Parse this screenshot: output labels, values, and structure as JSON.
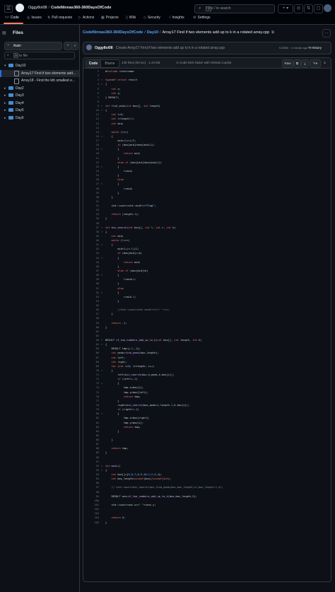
{
  "header": {
    "owner": "Oggy8oi08",
    "repo": "CodeNinnas360-360DaysOfCode",
    "search_placeholder": "Type / to search",
    "tabs": [
      {
        "label": "Code",
        "icon": "code-icon"
      },
      {
        "label": "Issues",
        "icon": "issue-icon"
      },
      {
        "label": "Pull requests",
        "icon": "pull-request-icon"
      },
      {
        "label": "Actions",
        "icon": "play-icon"
      },
      {
        "label": "Projects",
        "icon": "table-icon"
      },
      {
        "label": "Wiki",
        "icon": "book-icon"
      },
      {
        "label": "Security",
        "icon": "shield-icon"
      },
      {
        "label": "Insights",
        "icon": "graph-icon"
      },
      {
        "label": "Settings",
        "icon": "gear-icon"
      }
    ]
  },
  "sidebar": {
    "title": "Files",
    "branch": "main",
    "goto_placeholder": "Go to file",
    "goto_key": "t",
    "tree": [
      {
        "label": "Day10",
        "type": "folder",
        "open": true,
        "depth": 0
      },
      {
        "label": "Array17 Find if two elements add up to k in a rotated array.cpp",
        "display": "Array17 Find if two elements add...",
        "type": "file",
        "depth": 1,
        "selected": true
      },
      {
        "label": "Array18 - Find the kth smallest element",
        "display": "Array18 - Find the kth smallest e...",
        "type": "file",
        "depth": 1
      },
      {
        "label": "Day2",
        "type": "folder",
        "depth": 0
      },
      {
        "label": "Day3",
        "type": "folder",
        "depth": 0
      },
      {
        "label": "Day4",
        "type": "folder",
        "depth": 0
      },
      {
        "label": "Day5",
        "type": "folder",
        "depth": 0
      },
      {
        "label": "Day6",
        "type": "folder",
        "depth": 0
      }
    ]
  },
  "main": {
    "path_repo": "CodeNinnas360-360DaysOfCode",
    "path_folder": "Day10",
    "path_file": "Array17 Find if two elements add up to k in a rotated array.cpp",
    "commit": {
      "author": "Oggy8oi08",
      "message": "Create Array17 Find if two elements add up to k in a rotated array.cpp",
      "sha_time": "f125f3b · 1 minute ago",
      "history_label": "History"
    },
    "toolbar": {
      "code_tab": "Code",
      "blame_tab": "Blame",
      "file_info": "140 lines (94 loc) · 1.44 KB",
      "copilot": "Code 55% faster with GitHub Copilot",
      "raw_label": "Raw"
    },
    "code": [
      "#include <iostream>",
      "",
      "typedef struct result",
      "{",
      "    int x;",
      "    int y;",
      "} RESULT;",
      "",
      "int find_peak(int box[], int length)",
      "{",
      "    int l=0;",
      "    int r=length-1;",
      "    int mid;",
      "",
      "    while (l<r)",
      "    {",
      "        mid=(l+r)/2;",
      "        if (box[mid]>box[mid+1])",
      "        {",
      "            return mid;",
      "        }",
      "        else if (box[mid]<box[mid+1])",
      "        {",
      "            l=mid;",
      "        }",
      "        else",
      "        {",
      "            r=mid;",
      "        }",
      "    }",
      "",
      "    std::cout<<std::endl<<\"Flag\";",
      "",
      "    return (length-1);",
      "}",
      "",
      "int bin_search(int box[], int l, int r, int k)",
      "{",
      "    int mid;",
      "    while (l<=r)",
      "    {",
      "        mid=l+(r-l)/2;",
      "        if (box[mid]==k)",
      "        {",
      "            return mid;",
      "        }",
      "        else if (box[mid]<k)",
      "        {",
      "            l=mid+1;",
      "        }",
      "        else",
      "        {",
      "            r=mid-1;",
      "        }",
      "",
      "        //std::cout<<std::endl<<l<<\" \"<<r;",
      "    }",
      "",
      "    return -1;",
      "}",
      "",
      "",
      "RESULT if_two_numbers_add_up_to_k(int box[], int length, int k)",
      "{",
      "    RESULT tmp={-1,-1};",
      "    int peak=find_peak(box,length);",
      "    int left;",
      "    int right;",
      "    for (int i=0; i<length; i++)",
      "    {",
      "        left=bin_search(box,0,peak,k-box[i]);",
      "        if (left!=-1)",
      "        {",
      "            tmp.x=box[i];",
      "            tmp.y=box[left];",
      "            return tmp;",
      "        }",
      "        right=bin_search(box,peak+1,length-1,k-box[i]);",
      "        if (right!=-1)",
      "        {",
      "            tmp.x=box[right];",
      "            tmp.y=box[i];",
      "            return tmp;",
      "        }",
      "",
      "    }",
      "",
      "    return tmp;",
      "}",
      "",
      "",
      "int main()",
      "{",
      "    int box[]={5,6,7,8,9,10,1,2,3,4};",
      "    int box_length=sizeof(box)/sizeof(int);",
      "",
      "    // std::cout<<bin_search(box,find_peak(box,box_length)+1,box_length-1,4);",
      "",
      "    RESULT ans=if_two_numbers_add_up_to_k(box,box_length,9);",
      "",
      "    std::cout<<ans.x<<\" \"<<ans.y;",
      "",
      "",
      "    return 0;",
      "}"
    ]
  }
}
